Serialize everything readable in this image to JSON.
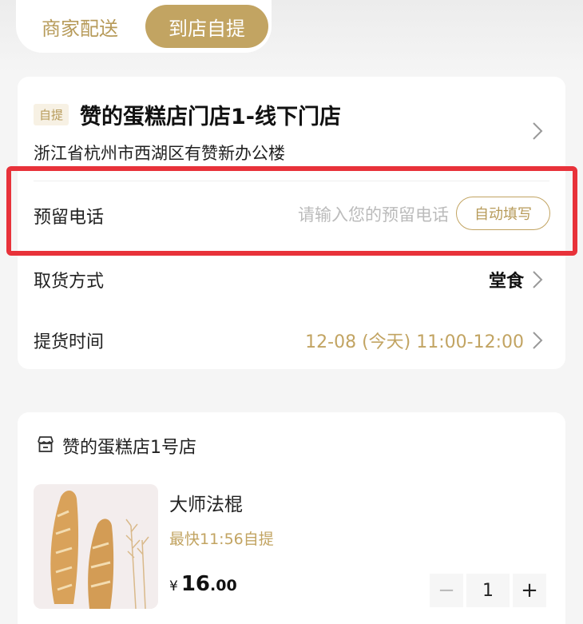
{
  "tabs": {
    "delivery_label": "商家配送",
    "pickup_label": "到店自提",
    "active": "pickup"
  },
  "store": {
    "tag": "自提",
    "name": "赞的蛋糕店门店1-线下门店",
    "address": "浙江省杭州市西湖区有赞新办公楼"
  },
  "phone": {
    "label": "预留电话",
    "value": "",
    "placeholder": "请输入您的预留电话",
    "autofill_label": "自动填写"
  },
  "pickup_method": {
    "label": "取货方式",
    "value": "堂食"
  },
  "pickup_time": {
    "label": "提货时间",
    "value": "12-08 (今天) 11:00-12:00"
  },
  "shop": {
    "icon": "store-icon",
    "name": "赞的蛋糕店1号店"
  },
  "product": {
    "name": "大师法棍",
    "eta": "最快11:56自提",
    "currency": "¥",
    "price_int": "16",
    "price_dec": ".00",
    "quantity": "1",
    "minus_symbol": "−",
    "plus_symbol": "+"
  },
  "colors": {
    "accent": "#c2a462",
    "highlight_border": "#e8323a",
    "background": "#f5f5f5"
  }
}
